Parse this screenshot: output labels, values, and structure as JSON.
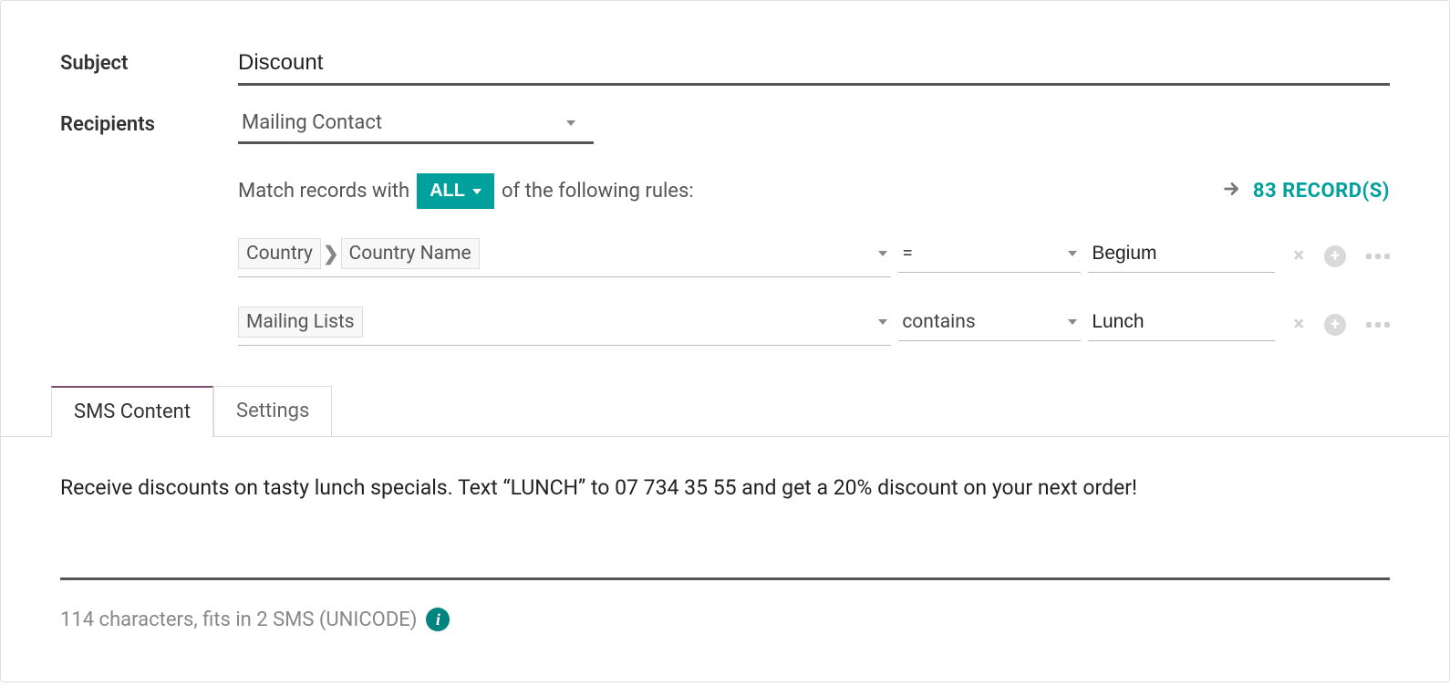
{
  "labels": {
    "subject": "Subject",
    "recipients": "Recipients"
  },
  "subject_value": "Discount",
  "recipients_value": "Mailing Contact",
  "match": {
    "pre": "Match records with",
    "mode": "ALL",
    "post": "of the following rules:"
  },
  "records": {
    "text": "83 RECORD(S)"
  },
  "rules": [
    {
      "field_path": [
        "Country",
        "Country Name"
      ],
      "operator": "=",
      "value": "Begium"
    },
    {
      "field_path": [
        "Mailing Lists"
      ],
      "operator": "contains",
      "value": "Lunch"
    }
  ],
  "tabs": {
    "sms_content": "SMS Content",
    "settings": "Settings"
  },
  "sms_body": "Receive discounts on tasty lunch specials. Text “LUNCH” to 07 734 35 55 and get a 20% discount on your next order!",
  "sms_summary": "114 characters, fits in 2 SMS (UNICODE)"
}
